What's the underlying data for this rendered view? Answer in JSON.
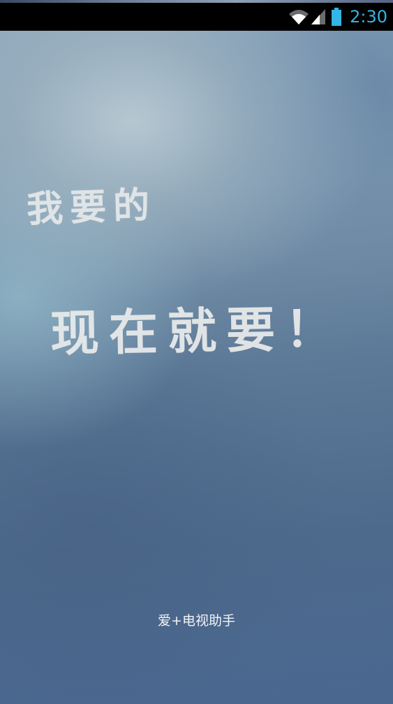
{
  "status_bar": {
    "time": "2:30",
    "icons": [
      "wifi-icon",
      "signal-icon",
      "battery-icon"
    ],
    "accent_color": "#33b5e5"
  },
  "splash": {
    "slogan_line1": "我要的",
    "slogan_line2": "现在就要！",
    "app_name": "爱+电视助手"
  }
}
